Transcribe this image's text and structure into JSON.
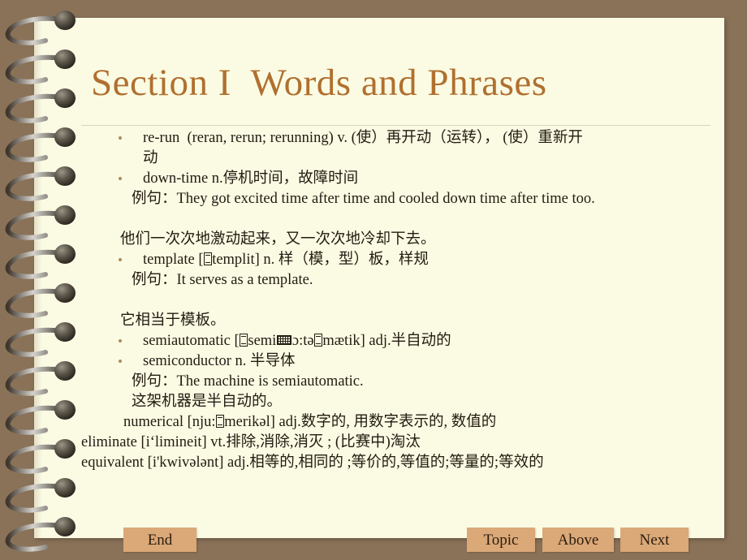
{
  "theme": {
    "background_color": "#8a7258",
    "page_color": "#fbfbe4",
    "title_color": "#b0702f",
    "body_color": "#231b10",
    "button_color": "#dba878",
    "bullet_color": "#b08858"
  },
  "slide": {
    "title": "Section I  Words and Phrases"
  },
  "content": {
    "lines": [
      {
        "id": "rerun",
        "style": "bulleted",
        "bullet": true,
        "text": "re-run  (reran, rerun; rerunning) v. (使）再开动（运转）， (使）重新开"
      },
      {
        "id": "rerun-cont",
        "style": "ind-cont",
        "bullet": false,
        "text": "动"
      },
      {
        "id": "downtime",
        "style": "bulleted",
        "bullet": true,
        "text": "down-time n.停机时间，故障时间"
      },
      {
        "id": "downtime-example",
        "style": "ind-ex",
        "bullet": false,
        "text": "例句：They got excited time after time and cooled down time after time too."
      },
      {
        "id": "spacer-1",
        "style": "spacer",
        "bullet": false,
        "text": ""
      },
      {
        "id": "downtime-translation",
        "style": "ind-trans",
        "bullet": false,
        "text": "他们一次次地激动起来，又一次次地冷却下去。"
      },
      {
        "id": "template",
        "style": "bulleted",
        "bullet": true,
        "text": "template [□templit] n. 样（模，型）板，样规"
      },
      {
        "id": "template-example",
        "style": "ind-ex",
        "bullet": false,
        "text": "例句：It serves as a template."
      },
      {
        "id": "spacer-2",
        "style": "spacer",
        "bullet": false,
        "text": ""
      },
      {
        "id": "template-translation",
        "style": "ind-trans",
        "bullet": false,
        "text": "它相当于模板。"
      },
      {
        "id": "semiautomatic",
        "style": "bulleted",
        "bullet": true,
        "text": "semiautomatic [□semi□ɔ:tə□mætik] adj.半自动的"
      },
      {
        "id": "semiconductor",
        "style": "bulleted",
        "bullet": true,
        "text": "semiconductor n. 半导体"
      },
      {
        "id": "semiautomatic-example",
        "style": "ind-ex",
        "bullet": false,
        "text": "例句：The machine is semiautomatic."
      },
      {
        "id": "semiautomatic-translation",
        "style": "ind-ex",
        "bullet": false,
        "text": "这架机器是半自动的。"
      },
      {
        "id": "numerical",
        "style": "ind-word",
        "bullet": false,
        "text": "numerical [nju:□merikəl] adj.数字的, 用数字表示的, 数值的"
      },
      {
        "id": "eliminate",
        "style": "ind-flush",
        "bullet": false,
        "text": "eliminate [i‘limineit] vt.排除,消除,消灭 ; (比赛中)淘汰"
      },
      {
        "id": "equivalent",
        "style": "ind-flush",
        "bullet": false,
        "text": "equivalent [i'kwivələnt] adj.相等的,相同的 ;等价的,等值的;等量的;等效的"
      }
    ]
  },
  "nav": {
    "end_label": "End",
    "topic_label": "Topic",
    "above_label": "Above",
    "next_label": "Next"
  }
}
